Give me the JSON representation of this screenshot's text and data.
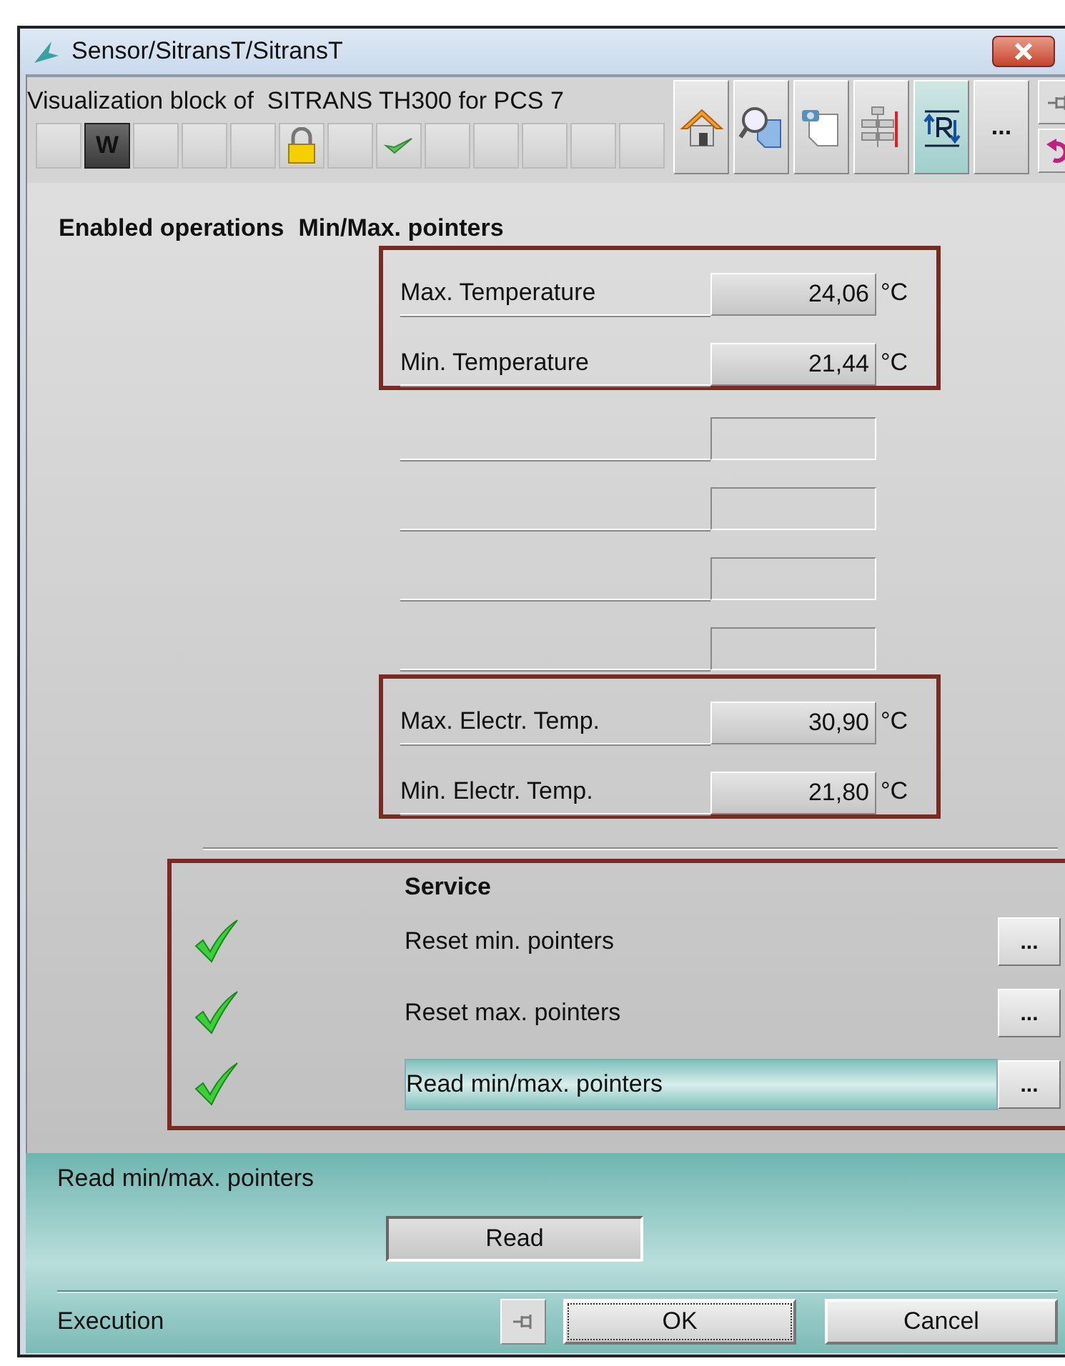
{
  "window": {
    "title": "Sensor/SitransT/SitransT"
  },
  "toolbar": {
    "caption": "Visualization block of  SITRANS TH300 for PCS 7",
    "status_cells": [
      {
        "kind": "empty"
      },
      {
        "kind": "w",
        "text": "W"
      },
      {
        "kind": "empty"
      },
      {
        "kind": "empty"
      },
      {
        "kind": "empty"
      },
      {
        "kind": "lock"
      },
      {
        "kind": "empty"
      },
      {
        "kind": "check"
      },
      {
        "kind": "empty"
      },
      {
        "kind": "empty"
      },
      {
        "kind": "empty"
      },
      {
        "kind": "empty"
      },
      {
        "kind": "empty"
      }
    ],
    "buttons": [
      {
        "kind": "home",
        "selected": false
      },
      {
        "kind": "zoom",
        "selected": false
      },
      {
        "kind": "faceplate",
        "selected": false
      },
      {
        "kind": "trend",
        "selected": false
      },
      {
        "kind": "parameter",
        "selected": true
      },
      {
        "kind": "more",
        "text": "...",
        "selected": false
      }
    ],
    "side_buttons": [
      {
        "kind": "pin"
      },
      {
        "kind": "undo"
      }
    ]
  },
  "headings": {
    "left": "Enabled operations",
    "right": "Min/Max. pointers"
  },
  "pointer_groups": [
    {
      "highlighted": true,
      "rows": [
        {
          "kind": "value",
          "label": "Max. Temperature",
          "value": "24,06",
          "unit": "°C"
        },
        {
          "kind": "value",
          "label": "Min. Temperature",
          "value": "21,44",
          "unit": "°C"
        }
      ]
    },
    {
      "highlighted": false,
      "rows": [
        {
          "kind": "blank"
        },
        {
          "kind": "blank"
        },
        {
          "kind": "blank"
        },
        {
          "kind": "blank"
        }
      ]
    },
    {
      "highlighted": true,
      "rows": [
        {
          "kind": "value",
          "label": "Max. Electr. Temp.",
          "value": "30,90",
          "unit": "°C"
        },
        {
          "kind": "value",
          "label": "Min. Electr. Temp.",
          "value": "21,80",
          "unit": "°C"
        }
      ]
    }
  ],
  "service": {
    "heading": "Service",
    "highlighted": true,
    "items": [
      {
        "label": "Reset min. pointers",
        "enabled": true,
        "selected": false,
        "button": "..."
      },
      {
        "label": "Reset max. pointers",
        "enabled": true,
        "selected": false,
        "button": "..."
      },
      {
        "label": "Read min/max. pointers",
        "enabled": true,
        "selected": true,
        "button": "..."
      }
    ]
  },
  "panel": {
    "title": "Read min/max. pointers",
    "action": "Read",
    "footer_label": "Execution",
    "buttons": [
      "OK",
      "Cancel"
    ]
  }
}
